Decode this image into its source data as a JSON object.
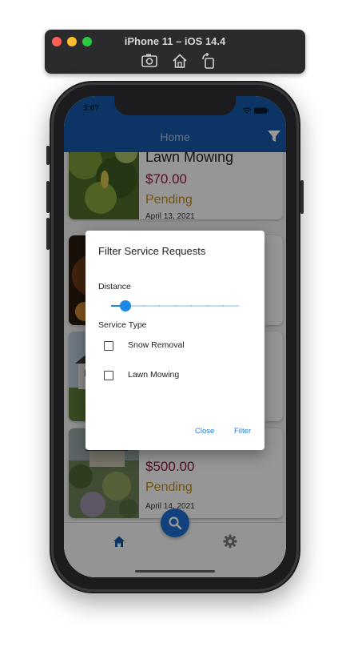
{
  "simulator": {
    "title": "iPhone 11 – iOS 14.4",
    "tools": [
      "screenshot-icon",
      "home-icon",
      "rotate-icon"
    ]
  },
  "status_bar": {
    "time": "3:07"
  },
  "nav_bar": {
    "title": "Home",
    "filter_icon": "filter-icon"
  },
  "requests": [
    {
      "title": "Lawn Mowing",
      "price": "$70.00",
      "status": "Pending",
      "date": "April 13, 2021"
    },
    {
      "title": "",
      "price": "",
      "status": "",
      "date": ""
    },
    {
      "title": "",
      "price": "",
      "status": "",
      "date": ""
    },
    {
      "title": "",
      "price": "$500.00",
      "status": "Pending",
      "date": "April 14, 2021"
    }
  ],
  "tab_bar": {
    "home_icon": "home-icon",
    "search_icon": "search-icon",
    "settings_icon": "gear-icon"
  },
  "filter_dialog": {
    "title": "Filter Service Requests",
    "distance_label": "Distance",
    "distance_value_fraction": 0.11,
    "service_type_label": "Service Type",
    "service_types": [
      {
        "label": "Snow Removal",
        "checked": false
      },
      {
        "label": "Lawn Mowing",
        "checked": false
      }
    ],
    "close_label": "Close",
    "filter_label": "Filter"
  },
  "colors": {
    "primary": "#1457a8",
    "accent": "#1e88e5",
    "price": "#8b1a3a",
    "status_pending": "#c0891a"
  }
}
